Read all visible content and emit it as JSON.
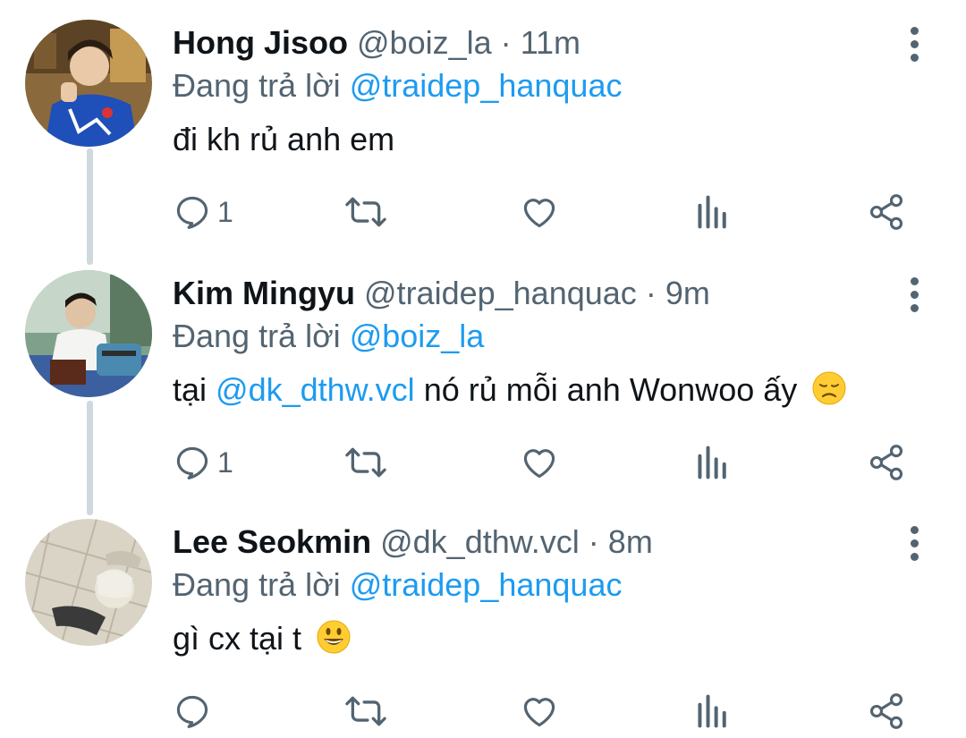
{
  "tweets": [
    {
      "name": "Hong Jisoo",
      "handle": "@boiz_la",
      "separator": "·",
      "time": "11m",
      "reply_prefix": "Đang trả lời",
      "reply_to": "@traidep_hanquac",
      "text_parts": [
        "đi kh rủ anh em"
      ],
      "reply_count": "1",
      "emoji": ""
    },
    {
      "name": "Kim Mingyu",
      "handle": "@traidep_hanquac",
      "separator": "·",
      "time": "9m",
      "reply_prefix": "Đang trả lời",
      "reply_to": "@boiz_la",
      "text_parts": [
        "tại ",
        "@dk_dthw.vcl",
        " nó rủ mỗi anh Wonwoo ấy"
      ],
      "reply_count": "1",
      "emoji": "disappointed-face"
    },
    {
      "name": "Lee Seokmin",
      "handle": "@dk_dthw.vcl",
      "separator": "·",
      "time": "8m",
      "reply_prefix": "Đang trả lời",
      "reply_to": "@traidep_hanquac",
      "text_parts": [
        "gì cx tại t"
      ],
      "reply_count": "",
      "emoji": "smiley-face"
    }
  ],
  "colors": {
    "link": "#1d9bf0",
    "secondary": "#536471",
    "thread_line": "#cfd9de"
  },
  "icons": [
    "reply-icon",
    "retweet-icon",
    "like-icon",
    "views-icon",
    "share-icon",
    "more-icon"
  ]
}
